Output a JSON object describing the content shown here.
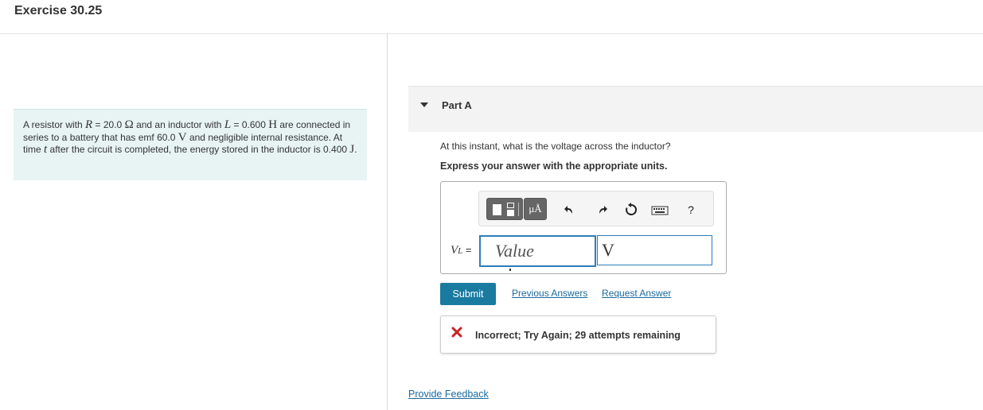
{
  "header": {
    "title": "Exercise 30.25"
  },
  "problem": {
    "t1": "A resistor with ",
    "R_sym": "R",
    "t2": " = 20.0 ",
    "ohm": "Ω",
    "t3": " and an inductor with ",
    "L_sym": "L",
    "t4": " = 0.600 ",
    "henry": "H",
    "t5": " are connected in series to a battery that has emf 60.0 ",
    "volt": "V",
    "t6": " and negligible internal resistance. At time ",
    "t_sym": "t",
    "t7": " after the circuit is completed, the energy stored in the inductor is 0.400 ",
    "joule": "J",
    "t8": "."
  },
  "part": {
    "label": "Part A"
  },
  "question": {
    "text": "At this instant, what is the voltage across the inductor?",
    "instruction": "Express your answer with the appropriate units."
  },
  "toolbar": {
    "units_label": "μÅ",
    "help_label": "?"
  },
  "answer": {
    "var_main": "V",
    "var_sub": "L",
    "equals": " =",
    "value_placeholder": "Value",
    "unit_value": "V"
  },
  "actions": {
    "submit_label": "Submit",
    "previous_answers": "Previous Answers",
    "request_answer": "Request Answer"
  },
  "feedback": {
    "message": "Incorrect; Try Again; 29 attempts remaining"
  },
  "footer": {
    "provide_feedback": "Provide Feedback"
  },
  "colors": {
    "accent": "#1a7aa0",
    "link": "#1a6aa0",
    "error": "#cc1f1f",
    "problem_bg": "#e8f4f4"
  }
}
